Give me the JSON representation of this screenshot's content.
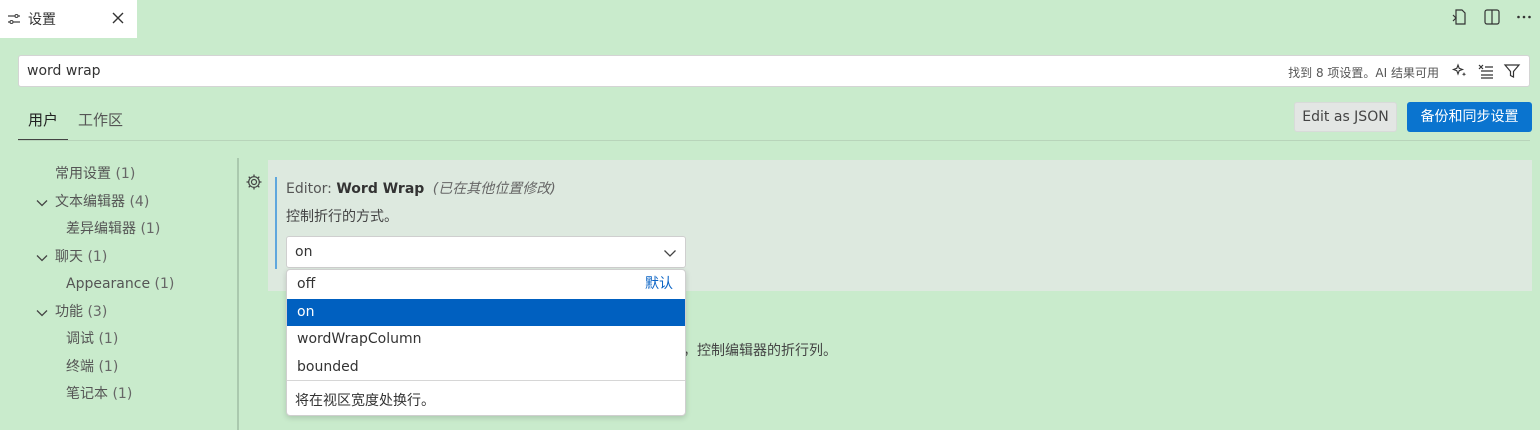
{
  "tab": {
    "title": "设置"
  },
  "search": {
    "value": "word wrap",
    "count_text": "找到 8 项设置。AI 结果可用"
  },
  "scope_tabs": [
    {
      "label": "用户"
    },
    {
      "label": "工作区"
    }
  ],
  "buttons": {
    "edit_json": "Edit as JSON",
    "sync": "备份和同步设置"
  },
  "tree": [
    {
      "label": "常用设置",
      "count": "(1)"
    },
    {
      "label": "文本编辑器",
      "count": "(4)"
    },
    {
      "label": "差异编辑器",
      "count": "(1)"
    },
    {
      "label": "聊天",
      "count": "(1)"
    },
    {
      "label": "Appearance",
      "count": "(1)"
    },
    {
      "label": "功能",
      "count": "(3)"
    },
    {
      "label": "调试",
      "count": "(1)"
    },
    {
      "label": "终端",
      "count": "(1)"
    },
    {
      "label": "笔记本",
      "count": "(1)"
    }
  ],
  "setting": {
    "category": "Editor: ",
    "key": "Word Wrap",
    "modified_note": "(已在其他位置修改)",
    "description": "控制折行的方式。",
    "value": "on"
  },
  "dropdown": {
    "options": [
      {
        "label": "off",
        "badge": "默认"
      },
      {
        "label": "on"
      },
      {
        "label": "wordWrapColumn"
      },
      {
        "label": "bounded"
      }
    ],
    "description": "将在视区宽度处换行。"
  },
  "next_setting_desc_fragment": "，控制编辑器的折行列。",
  "colors": {
    "accent": "#0a74cf",
    "selected_option": "#0060c0",
    "background": "#c9ebcc"
  }
}
